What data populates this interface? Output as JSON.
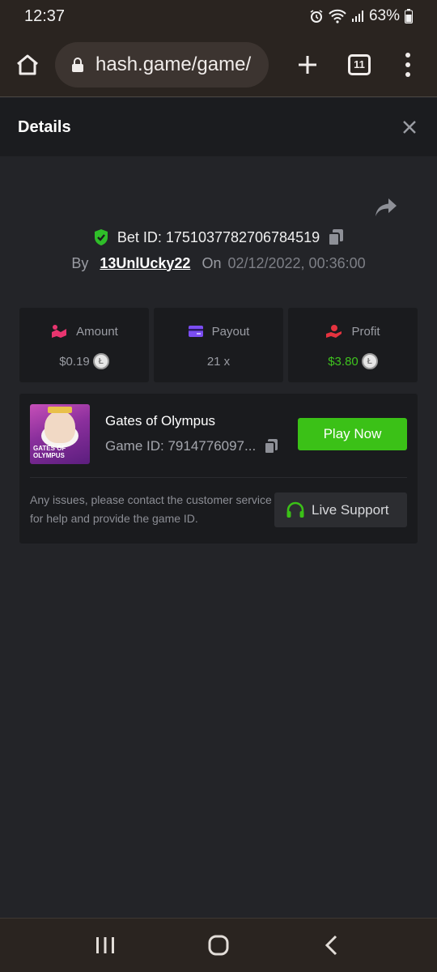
{
  "status_bar": {
    "time": "12:37",
    "battery": "63%",
    "icons": [
      "alarm-icon",
      "wifi-icon",
      "signal-icon",
      "battery-icon"
    ]
  },
  "browser": {
    "url": "hash.game/game/",
    "tab_count": "11",
    "icons": [
      "home-icon",
      "lock-icon",
      "plus-icon",
      "tabs-icon",
      "more-vertical-icon"
    ]
  },
  "details": {
    "title": "Details",
    "bet_id": "Bet ID: 1751037782706784519",
    "by_label": "By",
    "user": "13UnlUcky22",
    "on_label": "On",
    "date": "02/12/2022, 00:36:00"
  },
  "stats": [
    {
      "label": "Amount",
      "value": "$0.19",
      "icon": "amount-icon",
      "color": "#e8356f"
    },
    {
      "label": "Payout",
      "value": "21 x",
      "icon": "wallet-icon",
      "color": "#7b4df2"
    },
    {
      "label": "Profit",
      "value": "$3.80",
      "icon": "profit-icon",
      "color": "#e5333f",
      "value_color": "#3fc31f"
    }
  ],
  "game": {
    "name": "Gates of Olympus",
    "game_id": "Game ID: 7914776097...",
    "thumb_text": "GATES OF OLYMPUS",
    "play_label": "Play Now",
    "help_text": "Any issues, please contact the customer service for help and provide the game ID.",
    "support_label": "Live Support",
    "accent": "#3bc117"
  },
  "nav": {
    "icons": [
      "recent-apps-icon",
      "home-icon",
      "back-icon"
    ]
  }
}
